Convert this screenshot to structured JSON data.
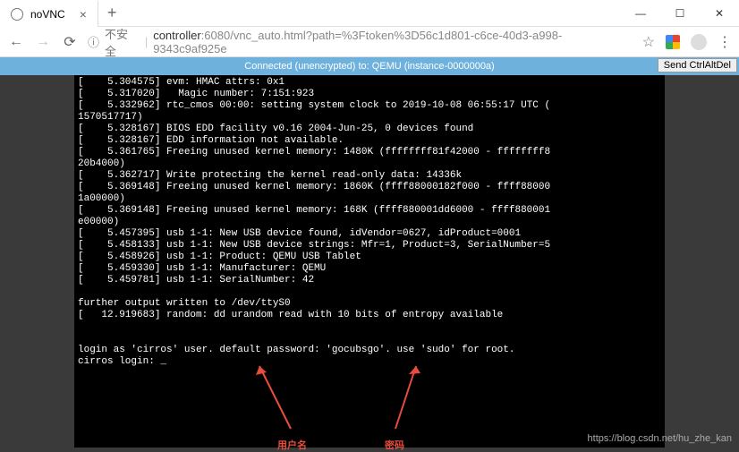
{
  "tab": {
    "title": "noVNC"
  },
  "url": {
    "warn_label": "不安全",
    "host": "controller",
    "port_path": ":6080/vnc_auto.html?path=%3Ftoken%3D56c1d801-c6ce-40d3-a998-9343c9af925e"
  },
  "vnc": {
    "status": "Connected (unencrypted) to: QEMU (instance-0000000a)",
    "send_btn": "Send CtrlAltDel"
  },
  "terminal_lines": [
    "[    5.304575] evm: HMAC attrs: 0x1",
    "[    5.317020]   Magic number: 7:151:923",
    "[    5.332962] rtc_cmos 00:00: setting system clock to 2019-10-08 06:55:17 UTC (",
    "1570517717)",
    "[    5.328167] BIOS EDD facility v0.16 2004-Jun-25, 0 devices found",
    "[    5.328167] EDD information not available.",
    "[    5.361765] Freeing unused kernel memory: 1480K (ffffffff81f42000 - ffffffff8",
    "20b4000)",
    "[    5.362717] Write protecting the kernel read-only data: 14336k",
    "[    5.369148] Freeing unused kernel memory: 1860K (ffff88000182f000 - ffff88000",
    "1a00000)",
    "[    5.369148] Freeing unused kernel memory: 168K (ffff880001dd6000 - ffff880001",
    "e00000)",
    "[    5.457395] usb 1-1: New USB device found, idVendor=0627, idProduct=0001",
    "[    5.458133] usb 1-1: New USB device strings: Mfr=1, Product=3, SerialNumber=5",
    "[    5.458926] usb 1-1: Product: QEMU USB Tablet",
    "[    5.459330] usb 1-1: Manufacturer: QEMU",
    "[    5.459781] usb 1-1: SerialNumber: 42",
    "",
    "further output written to /dev/ttyS0",
    "[   12.919683] random: dd urandom read with 10 bits of entropy available",
    "",
    "",
    "login as 'cirros' user. default password: 'gocubsgo'. use 'sudo' for root.",
    "cirros login: _"
  ],
  "annotations": {
    "username": "用户名",
    "password": "密码"
  },
  "watermark": "https://blog.csdn.net/hu_zhe_kan"
}
